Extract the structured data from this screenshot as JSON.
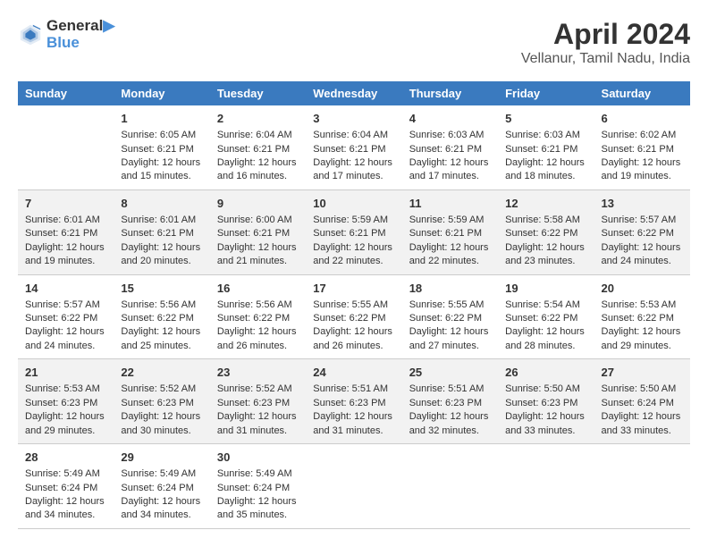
{
  "logo": {
    "line1": "General",
    "line2": "Blue"
  },
  "title": "April 2024",
  "subtitle": "Vellanur, Tamil Nadu, India",
  "days_header": [
    "Sunday",
    "Monday",
    "Tuesday",
    "Wednesday",
    "Thursday",
    "Friday",
    "Saturday"
  ],
  "weeks": [
    [
      {
        "day": "",
        "info": ""
      },
      {
        "day": "1",
        "info": "Sunrise: 6:05 AM\nSunset: 6:21 PM\nDaylight: 12 hours\nand 15 minutes."
      },
      {
        "day": "2",
        "info": "Sunrise: 6:04 AM\nSunset: 6:21 PM\nDaylight: 12 hours\nand 16 minutes."
      },
      {
        "day": "3",
        "info": "Sunrise: 6:04 AM\nSunset: 6:21 PM\nDaylight: 12 hours\nand 17 minutes."
      },
      {
        "day": "4",
        "info": "Sunrise: 6:03 AM\nSunset: 6:21 PM\nDaylight: 12 hours\nand 17 minutes."
      },
      {
        "day": "5",
        "info": "Sunrise: 6:03 AM\nSunset: 6:21 PM\nDaylight: 12 hours\nand 18 minutes."
      },
      {
        "day": "6",
        "info": "Sunrise: 6:02 AM\nSunset: 6:21 PM\nDaylight: 12 hours\nand 19 minutes."
      }
    ],
    [
      {
        "day": "7",
        "info": "Sunrise: 6:01 AM\nSunset: 6:21 PM\nDaylight: 12 hours\nand 19 minutes."
      },
      {
        "day": "8",
        "info": "Sunrise: 6:01 AM\nSunset: 6:21 PM\nDaylight: 12 hours\nand 20 minutes."
      },
      {
        "day": "9",
        "info": "Sunrise: 6:00 AM\nSunset: 6:21 PM\nDaylight: 12 hours\nand 21 minutes."
      },
      {
        "day": "10",
        "info": "Sunrise: 5:59 AM\nSunset: 6:21 PM\nDaylight: 12 hours\nand 22 minutes."
      },
      {
        "day": "11",
        "info": "Sunrise: 5:59 AM\nSunset: 6:21 PM\nDaylight: 12 hours\nand 22 minutes."
      },
      {
        "day": "12",
        "info": "Sunrise: 5:58 AM\nSunset: 6:22 PM\nDaylight: 12 hours\nand 23 minutes."
      },
      {
        "day": "13",
        "info": "Sunrise: 5:57 AM\nSunset: 6:22 PM\nDaylight: 12 hours\nand 24 minutes."
      }
    ],
    [
      {
        "day": "14",
        "info": "Sunrise: 5:57 AM\nSunset: 6:22 PM\nDaylight: 12 hours\nand 24 minutes."
      },
      {
        "day": "15",
        "info": "Sunrise: 5:56 AM\nSunset: 6:22 PM\nDaylight: 12 hours\nand 25 minutes."
      },
      {
        "day": "16",
        "info": "Sunrise: 5:56 AM\nSunset: 6:22 PM\nDaylight: 12 hours\nand 26 minutes."
      },
      {
        "day": "17",
        "info": "Sunrise: 5:55 AM\nSunset: 6:22 PM\nDaylight: 12 hours\nand 26 minutes."
      },
      {
        "day": "18",
        "info": "Sunrise: 5:55 AM\nSunset: 6:22 PM\nDaylight: 12 hours\nand 27 minutes."
      },
      {
        "day": "19",
        "info": "Sunrise: 5:54 AM\nSunset: 6:22 PM\nDaylight: 12 hours\nand 28 minutes."
      },
      {
        "day": "20",
        "info": "Sunrise: 5:53 AM\nSunset: 6:22 PM\nDaylight: 12 hours\nand 29 minutes."
      }
    ],
    [
      {
        "day": "21",
        "info": "Sunrise: 5:53 AM\nSunset: 6:23 PM\nDaylight: 12 hours\nand 29 minutes."
      },
      {
        "day": "22",
        "info": "Sunrise: 5:52 AM\nSunset: 6:23 PM\nDaylight: 12 hours\nand 30 minutes."
      },
      {
        "day": "23",
        "info": "Sunrise: 5:52 AM\nSunset: 6:23 PM\nDaylight: 12 hours\nand 31 minutes."
      },
      {
        "day": "24",
        "info": "Sunrise: 5:51 AM\nSunset: 6:23 PM\nDaylight: 12 hours\nand 31 minutes."
      },
      {
        "day": "25",
        "info": "Sunrise: 5:51 AM\nSunset: 6:23 PM\nDaylight: 12 hours\nand 32 minutes."
      },
      {
        "day": "26",
        "info": "Sunrise: 5:50 AM\nSunset: 6:23 PM\nDaylight: 12 hours\nand 33 minutes."
      },
      {
        "day": "27",
        "info": "Sunrise: 5:50 AM\nSunset: 6:24 PM\nDaylight: 12 hours\nand 33 minutes."
      }
    ],
    [
      {
        "day": "28",
        "info": "Sunrise: 5:49 AM\nSunset: 6:24 PM\nDaylight: 12 hours\nand 34 minutes."
      },
      {
        "day": "29",
        "info": "Sunrise: 5:49 AM\nSunset: 6:24 PM\nDaylight: 12 hours\nand 34 minutes."
      },
      {
        "day": "30",
        "info": "Sunrise: 5:49 AM\nSunset: 6:24 PM\nDaylight: 12 hours\nand 35 minutes."
      },
      {
        "day": "",
        "info": ""
      },
      {
        "day": "",
        "info": ""
      },
      {
        "day": "",
        "info": ""
      },
      {
        "day": "",
        "info": ""
      }
    ]
  ]
}
